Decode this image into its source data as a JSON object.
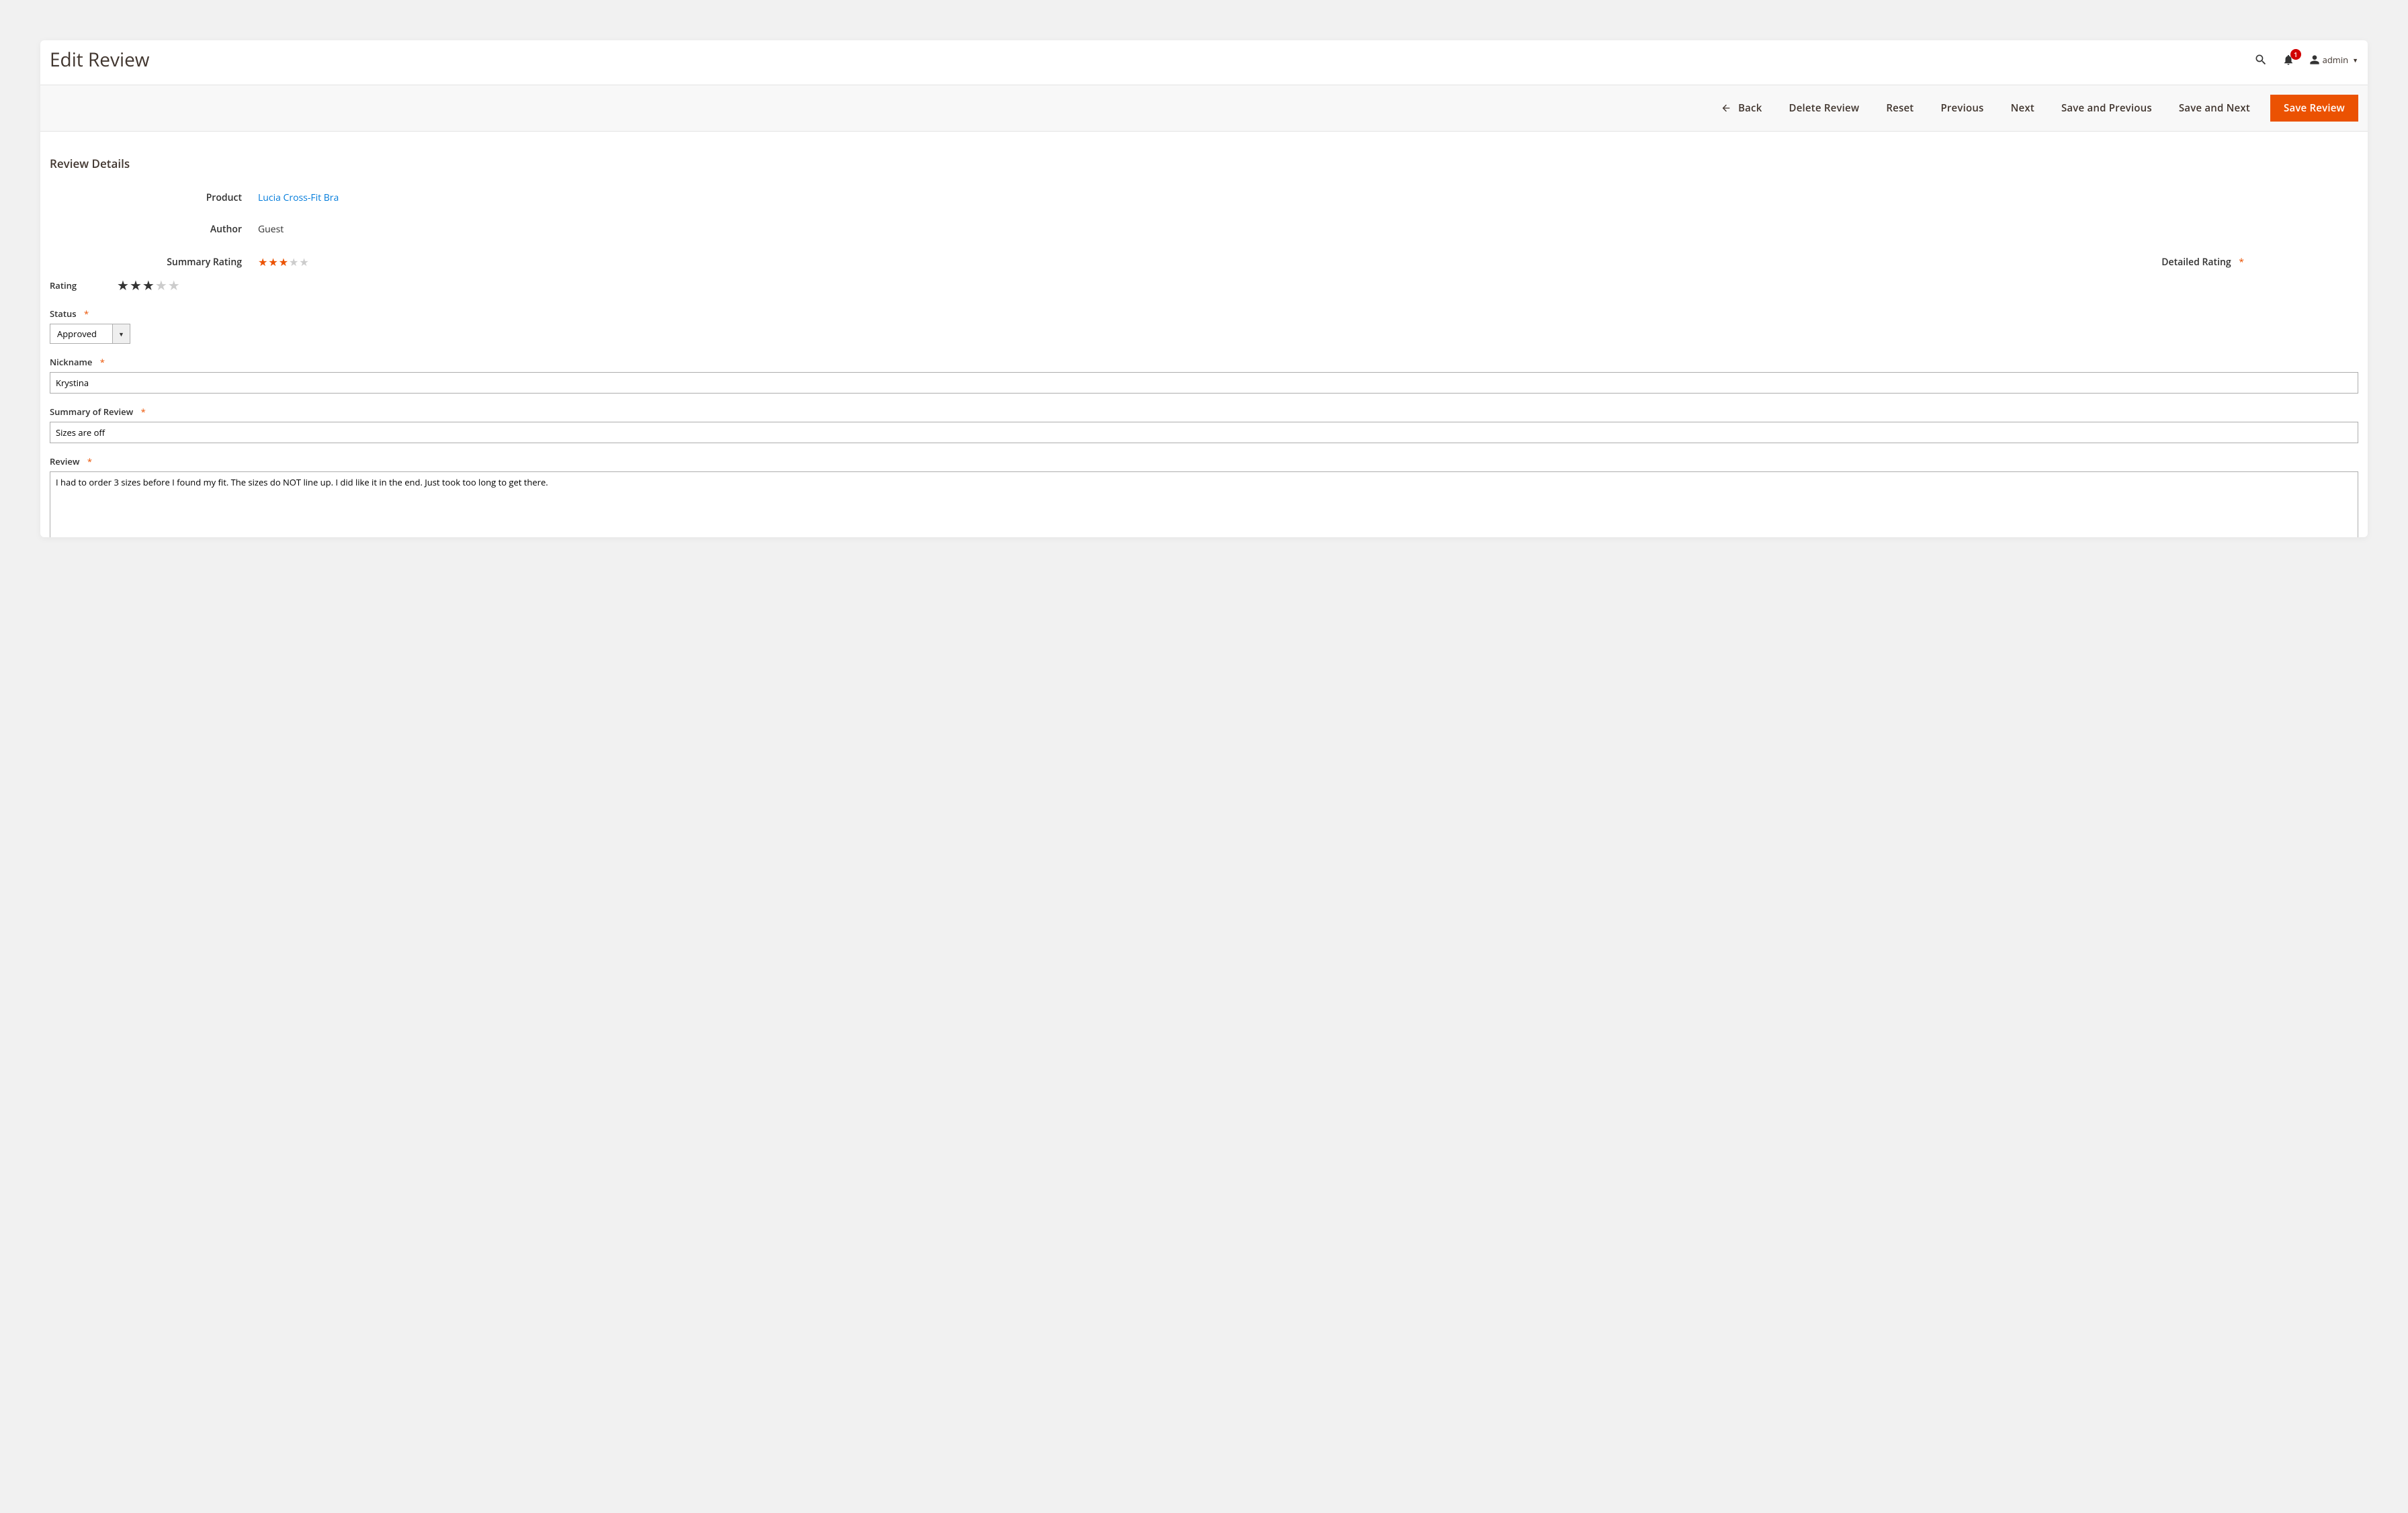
{
  "header": {
    "page_title": "Edit Review",
    "notification_count": "1",
    "user_name": "admin"
  },
  "actions": {
    "back": "Back",
    "delete": "Delete Review",
    "reset": "Reset",
    "previous": "Previous",
    "next": "Next",
    "save_previous": "Save and Previous",
    "save_next": "Save and Next",
    "save": "Save Review"
  },
  "section": {
    "title": "Review Details",
    "product_label": "Product",
    "product_value": "Lucia Cross-Fit Bra",
    "author_label": "Author",
    "author_value": "Guest",
    "summary_rating_label": "Summary Rating",
    "summary_rating_value": 3,
    "summary_rating_max": 5,
    "detailed_rating_label": "Detailed Rating"
  },
  "form": {
    "rating_label": "Rating",
    "rating_value": 3,
    "rating_max": 5,
    "status_label": "Status",
    "status_value": "Approved",
    "nickname_label": "Nickname",
    "nickname_value": "Krystina",
    "summary_label": "Summary of Review",
    "summary_value": "Sizes are off",
    "review_label": "Review",
    "review_value": "I had to order 3 sizes before I found my fit. The sizes do NOT line up. I did like it in the end. Just took too long to get there."
  },
  "required_mark": "*"
}
